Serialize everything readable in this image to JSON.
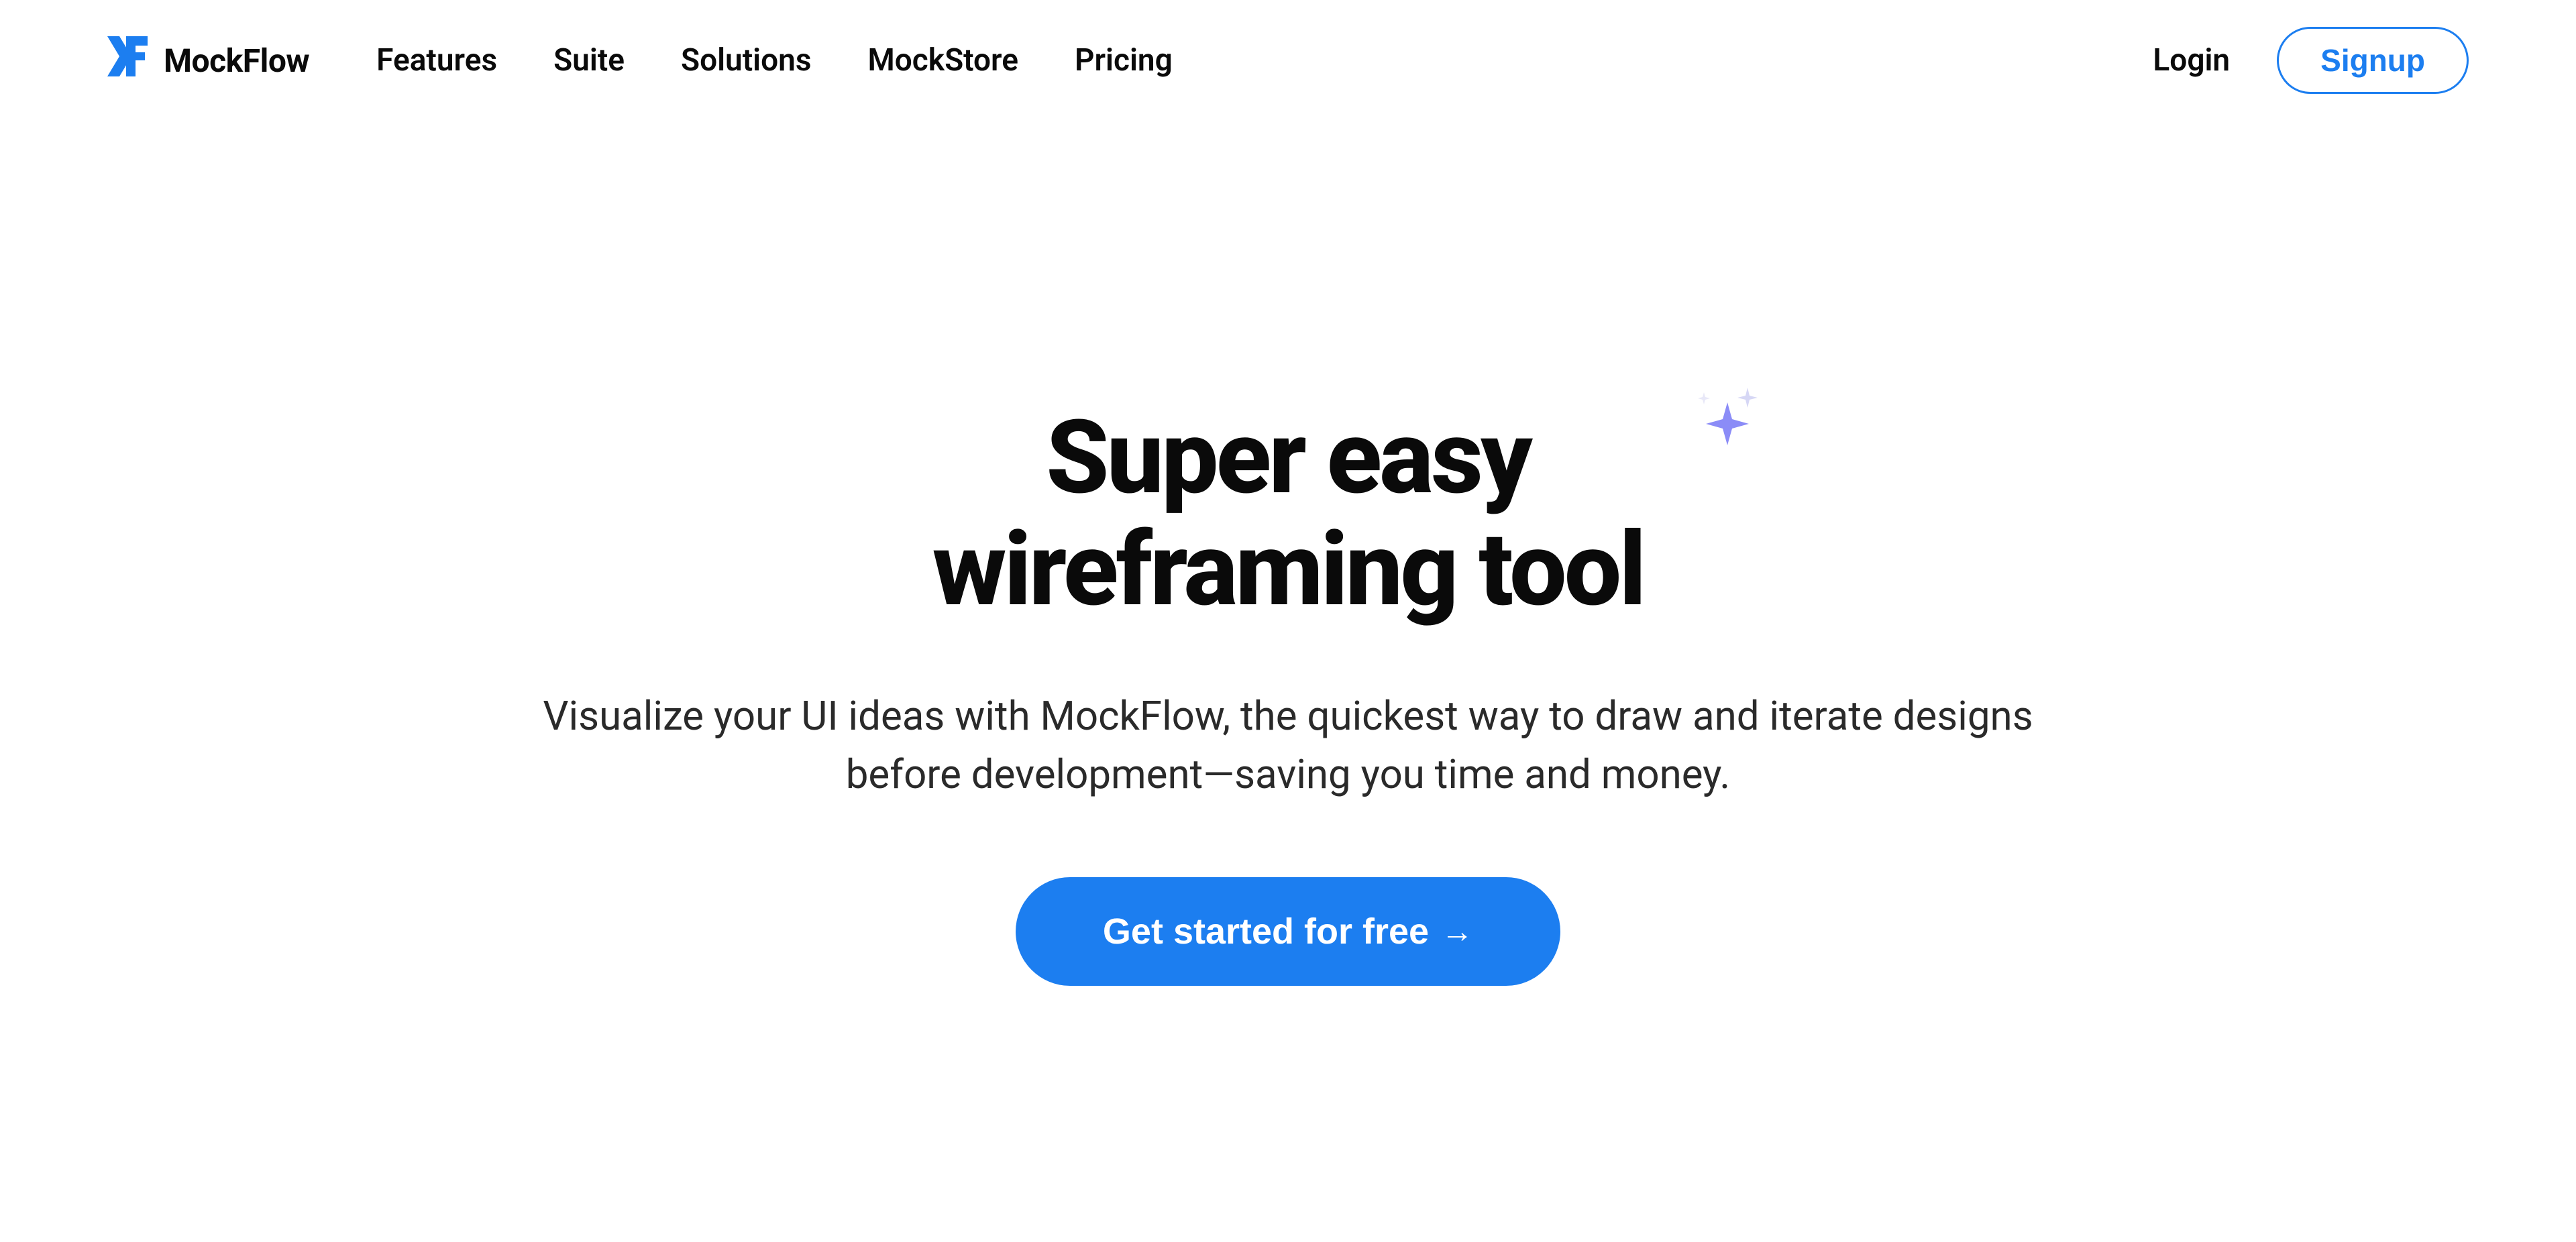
{
  "brand": {
    "name": "MockFlow"
  },
  "nav": {
    "items": [
      {
        "label": "Features"
      },
      {
        "label": "Suite"
      },
      {
        "label": "Solutions"
      },
      {
        "label": "MockStore"
      },
      {
        "label": "Pricing"
      }
    ]
  },
  "auth": {
    "login": "Login",
    "signup": "Signup"
  },
  "hero": {
    "title_line1": "Super easy",
    "title_line2": "wireframing tool",
    "subtitle": "Visualize your UI ideas with MockFlow, the quickest way to draw and iterate designs before development—saving you time and money.",
    "cta": "Get started for free"
  },
  "colors": {
    "accent": "#1c7ef0",
    "sparkle_primary": "#8b8cf7",
    "sparkle_secondary": "#d6d7f5"
  }
}
